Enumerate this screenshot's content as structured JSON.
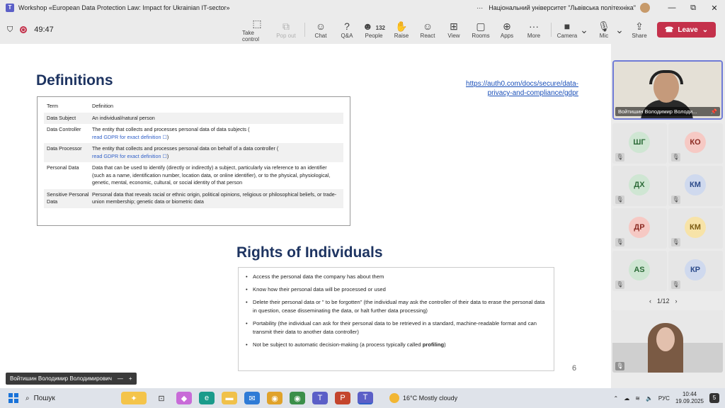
{
  "window": {
    "title": "Workshop «European Data Protection Law: Impact for Ukrainian IT-sector»",
    "more": "···",
    "org": "Національний університет \"Львівська політехніка\"",
    "min": "—",
    "restore": "⧉",
    "close": "✕"
  },
  "toolbar": {
    "timer": "49:47",
    "take_control": "Take control",
    "pop_out": "Pop out",
    "chat": "Chat",
    "qa": "Q&A",
    "people": "People",
    "people_count": "132",
    "raise": "Raise",
    "react": "React",
    "view": "View",
    "rooms": "Rooms",
    "apps": "Apps",
    "more": "More",
    "camera": "Camera",
    "mic": "Mic",
    "share": "Share",
    "leave": "Leave"
  },
  "slide": {
    "title": "Definitions",
    "link_line1": "https://auth0.com/docs/secure/data-",
    "link_line2": "privacy-and-compliance/gdpr",
    "table_headers": {
      "term": "Term",
      "definition": "Definition"
    },
    "rows": [
      {
        "term": "Data Subject",
        "definition": "An individual/natural person",
        "link": ""
      },
      {
        "term": "Data Controller",
        "definition": "The entity that collects and processes personal data of data subjects (",
        "link": "read GDPR for exact definition ☐",
        "close": ")"
      },
      {
        "term": "Data Processor",
        "definition": "The entity that collects and processes personal data on behalf of a data controller (",
        "link": "read GDPR for exact definition ☐",
        "close": ")"
      },
      {
        "term": "Personal Data",
        "definition": "Data that can be used to identify (directly or indirectly) a subject, particularly via reference to an identifier (such as a name, identification number, location data, or online identifier), or to the physical, physiological, genetic, mental, economic, cultural, or social identity of that person",
        "link": ""
      },
      {
        "term": "Sensitive Personal Data",
        "definition": "Personal data that reveals racial or ethnic origin, political opinions, religious or philosophical beliefs, or trade-union membership; genetic data or biometric data",
        "link": ""
      }
    ],
    "rights_title": "Rights of Individuals",
    "rights": [
      "Access the personal data the company has about them",
      "Know how their personal data will be processed or used",
      "Delete their personal data or \" to be forgotten\" (the individual may ask the controller of their data to erase the personal data in question, cease disseminating the data, or halt further data processing)",
      "Portability (the individual can ask for their personal data to be retrieved  in a standard, machine-readable format and can transmit their data to another data controller)",
      "Not be subject to automatic decision-making (a process typically called "
    ],
    "rights_bold": "profiling",
    "rights_end": ")",
    "page_number": "6",
    "presenter_name": "Войтишин Володимир Володимирович"
  },
  "side": {
    "main_name": "Войтишин Володимир Володи...",
    "tiles": [
      {
        "initials": "ШГ",
        "bg": "#cfe6d3",
        "fg": "#2c6b38"
      },
      {
        "initials": "КО",
        "bg": "#f6c9c4",
        "fg": "#8b2a22"
      },
      {
        "initials": "ДХ",
        "bg": "#cfe6d3",
        "fg": "#2c6b38"
      },
      {
        "initials": "КМ",
        "bg": "#cfd9ee",
        "fg": "#2b4a8a"
      },
      {
        "initials": "ДР",
        "bg": "#f6c9c4",
        "fg": "#8b2a22"
      },
      {
        "initials": "КМ",
        "bg": "#f7e3a8",
        "fg": "#7a5a10"
      },
      {
        "initials": "AS",
        "bg": "#cfe6d3",
        "fg": "#2c6b38"
      },
      {
        "initials": "КР",
        "bg": "#cfd9ee",
        "fg": "#2b4a8a"
      }
    ],
    "pager": "1/12"
  },
  "taskbar": {
    "search": "Пошук",
    "weather": "16°C  Mostly cloudy",
    "lang": "РУС",
    "time": "10:44",
    "date": "19.09.2025",
    "notif": "5"
  }
}
